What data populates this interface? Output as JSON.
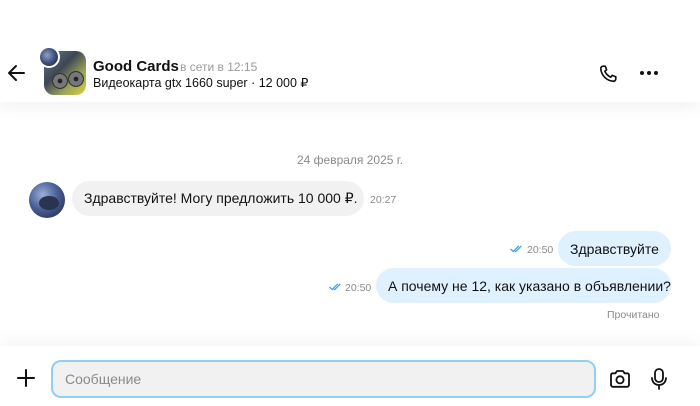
{
  "header": {
    "back_icon": "arrow-left-icon",
    "seller_name": "Good Cards",
    "seller_status": "в сети в 12:15",
    "product_line": "Видеокарта gtx 1660 super · 12 000 ₽",
    "call_icon": "phone-icon",
    "more_icon": "more-horizontal-icon"
  },
  "chat": {
    "date_separator": "24 февраля 2025 г.",
    "messages": [
      {
        "direction": "incoming",
        "text": "Здравствуйте! Могу предложить 10 000 ₽.",
        "time": "20:27"
      },
      {
        "direction": "outgoing",
        "text": "Здравствуйте",
        "time": "20:50",
        "read": true
      },
      {
        "direction": "outgoing",
        "text": "А почему не 12, как указано в объявлении?",
        "time": "20:50",
        "read": true
      }
    ],
    "read_status": "Прочитано"
  },
  "composer": {
    "placeholder": "Сообщение",
    "value": "",
    "add_icon": "plus-icon",
    "camera_icon": "camera-icon",
    "mic_icon": "microphone-icon"
  },
  "colors": {
    "outgoing_bubble": "#dff1ff",
    "incoming_bubble": "#f1f1f1",
    "input_border": "#8fd0f5",
    "read_ticks": "#3aa0e8"
  }
}
